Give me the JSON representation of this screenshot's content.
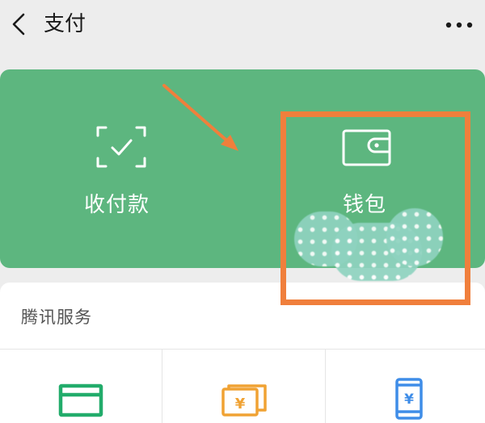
{
  "header": {
    "title": "支付",
    "back_icon": "chevron-left-icon",
    "more_icon": "more-dots-icon"
  },
  "pay_panel": {
    "background": "#5db67f",
    "actions": [
      {
        "label": "收付款",
        "icon": "scan-check-icon"
      },
      {
        "label": "钱包",
        "icon": "wallet-icon"
      }
    ]
  },
  "services": {
    "title": "腾讯服务",
    "items": [
      {
        "icon": "card-repay-icon",
        "color": "#22ac6b"
      },
      {
        "icon": "money-transfer-icon",
        "color": "#f0a233"
      },
      {
        "icon": "phone-recharge-icon",
        "color": "#3f8de8"
      }
    ]
  },
  "annotation": {
    "box_color": "#f07f3c",
    "arrow_color": "#f07f3c"
  }
}
